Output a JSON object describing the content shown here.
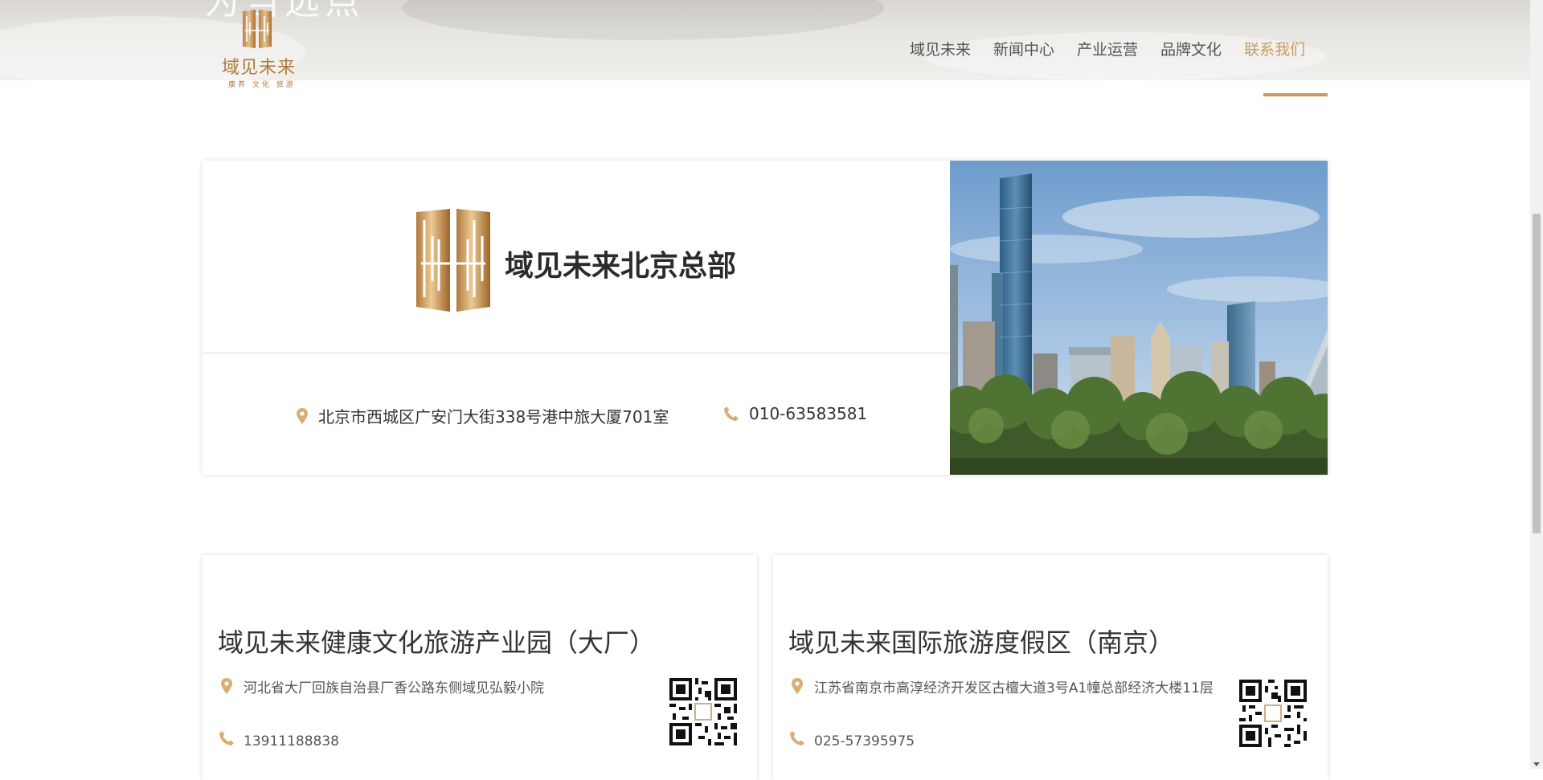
{
  "hero": {
    "heading": "为当远点"
  },
  "logo": {
    "name": "域见未来",
    "tagline": "康养 文化 旅游"
  },
  "nav": {
    "items": [
      "域见未来",
      "新闻中心",
      "产业运营",
      "品牌文化",
      "联系我们"
    ],
    "active_index": 4
  },
  "headquarters": {
    "title": "域见未来北京总部",
    "address": "北京市西城区广安门大街338号港中旅大厦701室",
    "phone": "010-63583581"
  },
  "branches": [
    {
      "title": "域见未来健康文化旅游产业园（大厂）",
      "address": "河北省大厂回族自治县厂香公路东侧域见弘毅小院",
      "phone": "13911188838"
    },
    {
      "title": "域见未来国际旅游度假区（南京）",
      "address": "江苏省南京市高淳经济开发区古檀大道3号A1幢总部经济大楼11层",
      "phone": "025-57395975"
    }
  ],
  "colors": {
    "accent": "#c99a5d",
    "brand_gold": "#b0793b"
  },
  "icons": {
    "location": "location-pin-icon",
    "phone": "phone-icon",
    "qr": "qr-code-icon"
  }
}
